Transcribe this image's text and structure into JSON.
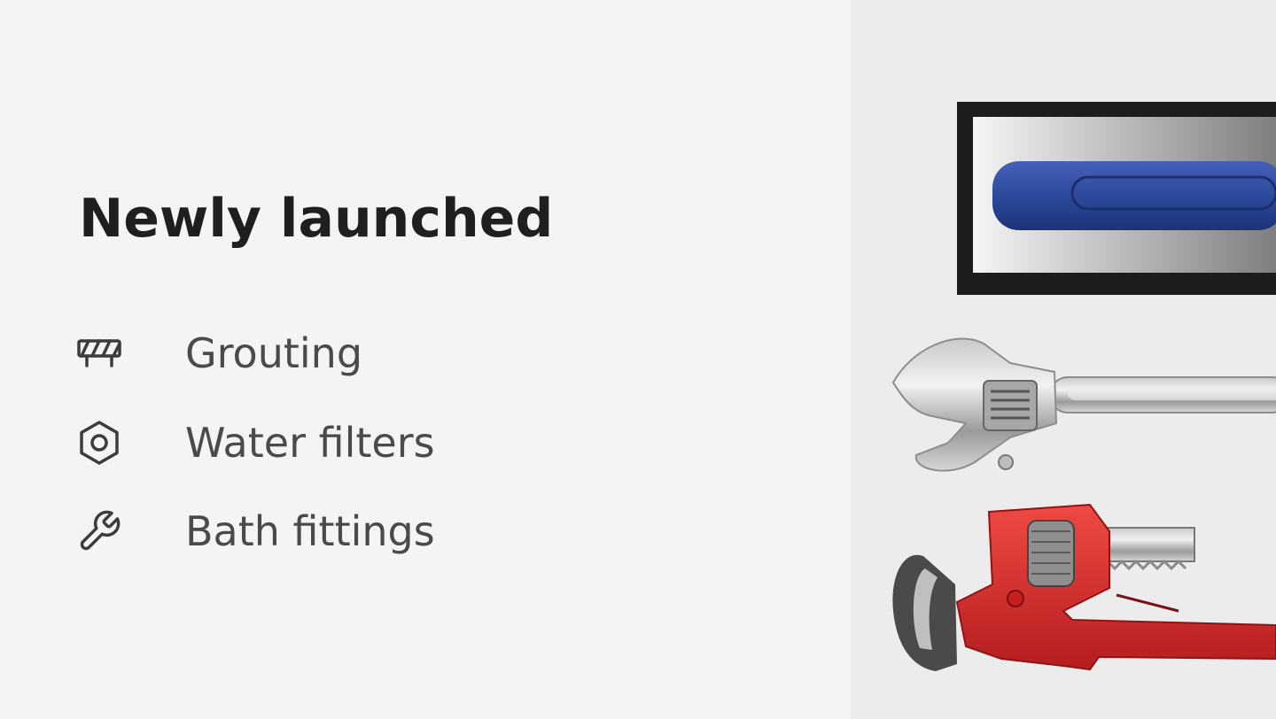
{
  "section": {
    "title": "Newly launched"
  },
  "items": [
    {
      "icon": "barrier-icon",
      "label": "Grouting"
    },
    {
      "icon": "hex-nut-icon",
      "label": "Water filters"
    },
    {
      "icon": "wrench-icon",
      "label": "Bath fittings"
    }
  ],
  "image": {
    "subjects": [
      "grout-float",
      "adjustable-wrench",
      "pipe-wrench"
    ]
  },
  "colors": {
    "background": "#f4f4f4",
    "image_background": "#ececec",
    "title": "#1f1f1f",
    "label": "#4a4a4a",
    "float_handle": "#2c4a9c",
    "pipe_wrench": "#d9282b"
  }
}
